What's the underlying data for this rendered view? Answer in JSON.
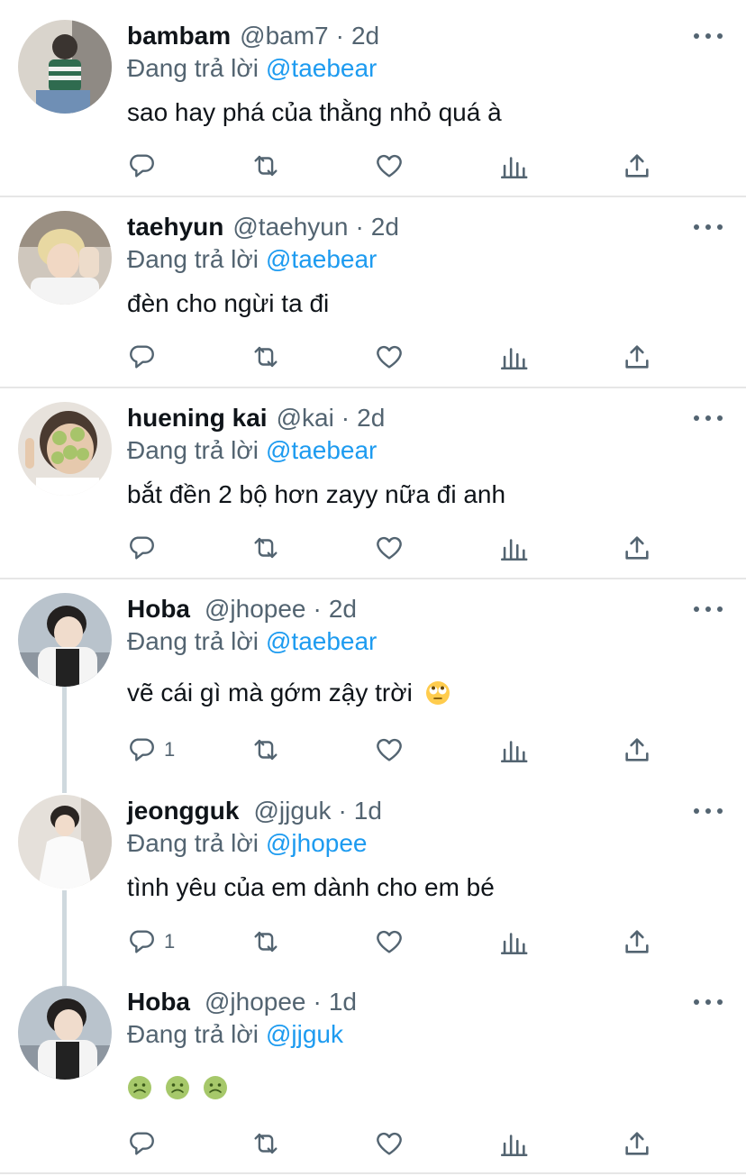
{
  "tweets": [
    {
      "name": "bambam",
      "handle": "@bam7",
      "time": "2d",
      "reply_prefix": "Đang trả lời",
      "reply_to": "@taebear",
      "text": "sao hay phá của thằng nhỏ quá à",
      "reply_count": ""
    },
    {
      "name": "taehyun",
      "handle": "@taehyun",
      "time": "2d",
      "reply_prefix": "Đang trả lời",
      "reply_to": "@taebear",
      "text": "đèn cho ngừi ta đi",
      "reply_count": ""
    },
    {
      "name": "huening kai",
      "handle": "@kai",
      "time": "2d",
      "reply_prefix": "Đang trả lời",
      "reply_to": "@taebear",
      "text": "bắt đền 2 bộ hơn zayy nữa đi anh",
      "reply_count": ""
    },
    {
      "name": "Hoba",
      "handle": "@jhopee",
      "time": "2d",
      "reply_prefix": "Đang trả lời",
      "reply_to": "@taebear",
      "text": "vẽ cái gì mà gớm zậy trời",
      "reply_count": "1"
    },
    {
      "name": "jeongguk",
      "handle": "@jjguk",
      "time": "1d",
      "reply_prefix": "Đang trả lời",
      "reply_to": "@jhopee",
      "text": "tình yêu của em dành cho em bé",
      "reply_count": "1"
    },
    {
      "name": "Hoba",
      "handle": "@jhopee",
      "time": "1d",
      "reply_prefix": "Đang trả lời",
      "reply_to": "@jjguk",
      "text": "",
      "reply_count": ""
    }
  ],
  "separator": "·",
  "colors": {
    "accent": "#1d9bf0",
    "secondary_text": "#536471",
    "primary_text": "#0f1419",
    "divider": "#e6e6e6",
    "thread_line": "#cfd9de"
  },
  "icons": [
    "reply-icon",
    "retweet-icon",
    "like-icon",
    "views-icon",
    "share-icon",
    "more-icon"
  ]
}
